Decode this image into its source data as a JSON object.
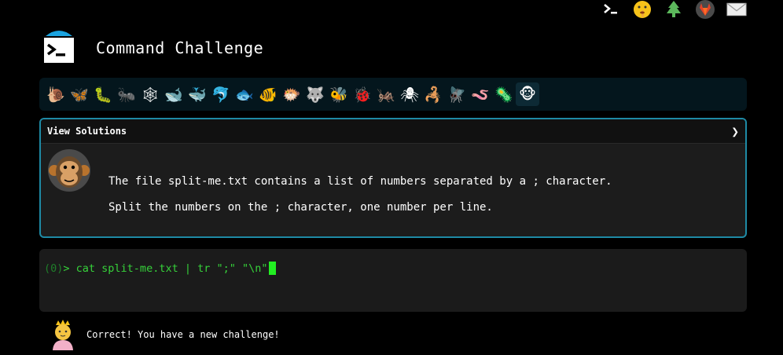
{
  "app": {
    "title": "Command Challenge"
  },
  "top_icons": [
    {
      "name": "terminal-icon"
    },
    {
      "name": "shushing-face-icon"
    },
    {
      "name": "tree-icon"
    },
    {
      "name": "gitlab-icon"
    },
    {
      "name": "envelope-icon"
    }
  ],
  "levels": [
    {
      "name": "snail",
      "glyph": "🐌"
    },
    {
      "name": "butterfly",
      "glyph": "🦋"
    },
    {
      "name": "caterpillar",
      "glyph": "🐛"
    },
    {
      "name": "ant",
      "glyph": "🐜"
    },
    {
      "name": "spider-web",
      "glyph": "🕸"
    },
    {
      "name": "whale",
      "glyph": "🐋"
    },
    {
      "name": "whale-spout",
      "glyph": "🐳"
    },
    {
      "name": "dolphin",
      "glyph": "🐬"
    },
    {
      "name": "fish",
      "glyph": "🐟"
    },
    {
      "name": "tropical-fish",
      "glyph": "🐠"
    },
    {
      "name": "blowfish",
      "glyph": "🐡"
    },
    {
      "name": "wolf",
      "glyph": "🐺"
    },
    {
      "name": "bee",
      "glyph": "🐝"
    },
    {
      "name": "ladybug",
      "glyph": "🐞"
    },
    {
      "name": "cricket",
      "glyph": "🦗"
    },
    {
      "name": "spider",
      "glyph": "🕷"
    },
    {
      "name": "scorpion",
      "glyph": "🦂"
    },
    {
      "name": "fly",
      "glyph": "🪰"
    },
    {
      "name": "worm",
      "glyph": "🪱"
    },
    {
      "name": "microbe",
      "glyph": "🦠"
    },
    {
      "name": "monkey",
      "glyph": "🐵",
      "current": true
    }
  ],
  "solutions": {
    "header_label": "View Solutions",
    "chevron": "❯",
    "line1": "The file split-me.txt contains a list of numbers separated by a ; character.",
    "line2": "Split the numbers on the ; character, one number per line."
  },
  "terminal": {
    "prompt_num": "(0)",
    "prompt_arrow": ">",
    "command": " cat split-me.txt | tr \";\" \"\\n\""
  },
  "result": {
    "message": "Correct! You have a new challenge!"
  },
  "colors": {
    "accent": "#1e8aa5",
    "prompt_green": "#36d23a",
    "cursor": "#22ee22",
    "background": "#000000"
  }
}
